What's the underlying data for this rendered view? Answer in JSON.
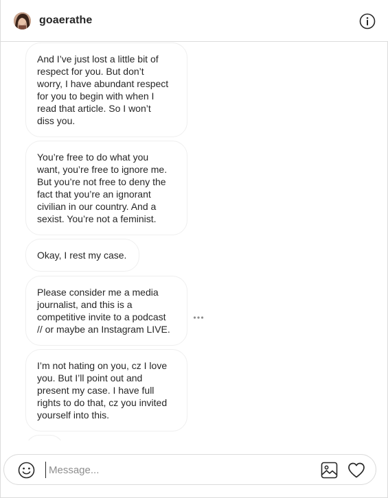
{
  "header": {
    "username": "goaerathe",
    "info_icon": "info-circle-icon"
  },
  "thread": {
    "messages": [
      {
        "text": "And I’ve just lost a little bit of\nrespect for you. But don’t\nworry, I have abundant respect\nfor you to begin with when I\nread that article. So I won’t\ndiss you."
      },
      {
        "text": "You’re free to do what you\nwant, you’re free to ignore me.\nBut you’re not free to deny the\nfact that you’re an ignorant\ncivilian in our country. And a\nsexist. You’re not a feminist."
      },
      {
        "text": "Okay, I rest my case."
      },
      {
        "text": "Please consider me a media\njournalist, and this is a\ncompetitive invite to a podcast\n// or maybe an Instagram LIVE."
      },
      {
        "text": "I’m not hating on you, cz I love\nyou. But I’ll point out and\npresent my case. I have full\nrights to do that, cz you invited\nyourself into this."
      }
    ],
    "more_icon": "more-horizontal-icon"
  },
  "composer": {
    "placeholder": "Message...",
    "value": "",
    "emoji_icon": "emoji-icon",
    "photo_icon": "image-icon",
    "like_icon": "heart-icon"
  }
}
